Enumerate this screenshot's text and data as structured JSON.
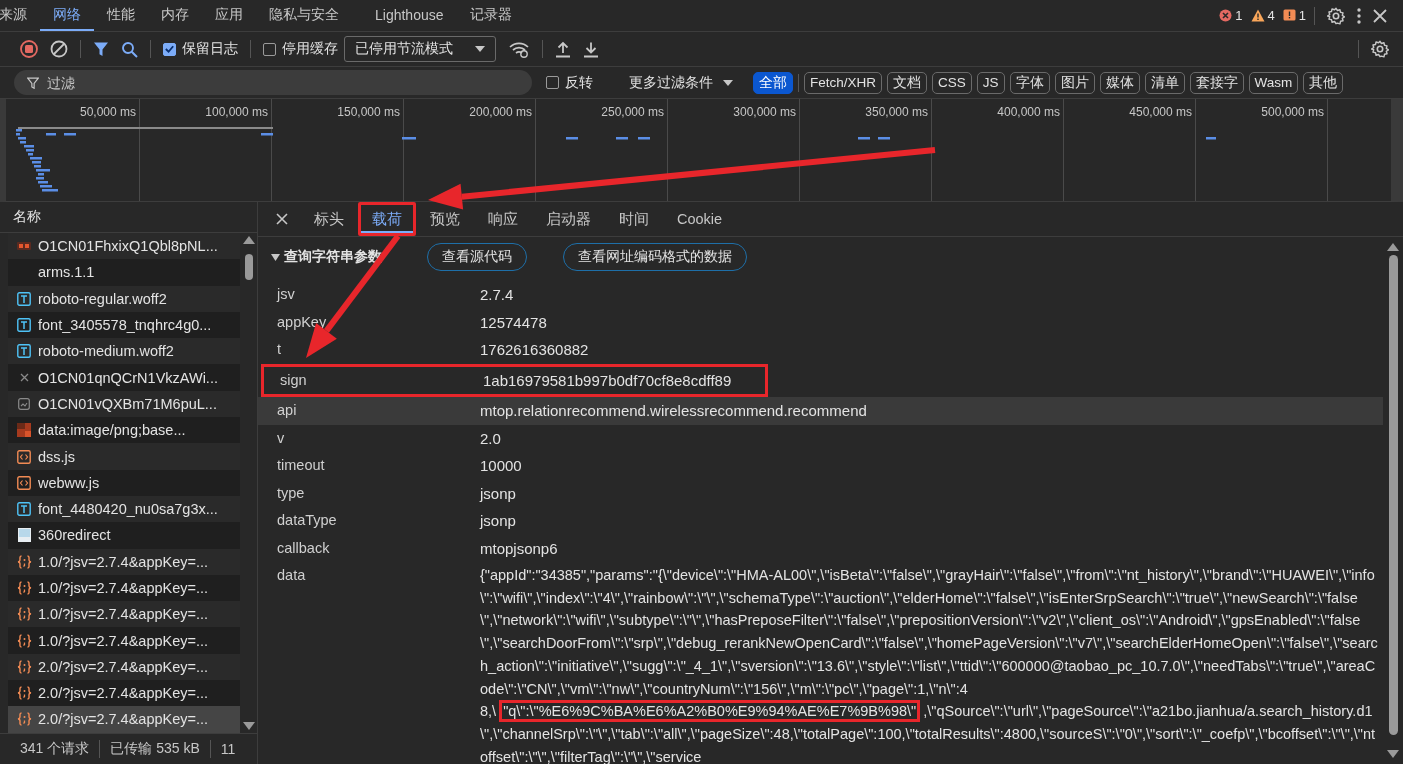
{
  "panel_tabs": [
    {
      "label": "来源",
      "selected": false
    },
    {
      "label": "网络",
      "selected": true
    },
    {
      "label": "性能",
      "selected": false
    },
    {
      "label": "内存",
      "selected": false
    },
    {
      "label": "应用",
      "selected": false
    },
    {
      "label": "隐私与安全",
      "selected": false
    },
    {
      "label": "Lighthouse",
      "selected": false
    },
    {
      "label": "记录器",
      "selected": false
    }
  ],
  "issue_counts": [
    {
      "kind": "error",
      "count": "1"
    },
    {
      "kind": "warning",
      "count": "4"
    },
    {
      "kind": "info",
      "count": "1"
    }
  ],
  "toolbar": {
    "preserve_log": {
      "label": "保留日志",
      "checked": true
    },
    "disable_cache": {
      "label": "停用缓存",
      "checked": false
    },
    "throttling": "已停用节流模式"
  },
  "filter": {
    "placeholder": "过滤",
    "invert": {
      "label": "反转",
      "checked": false
    },
    "more_filters": "更多过滤条件",
    "types": [
      {
        "label": "全部",
        "selected": true
      },
      {
        "label": "Fetch/XHR",
        "selected": false
      },
      {
        "label": "文档",
        "selected": false
      },
      {
        "label": "CSS",
        "selected": false
      },
      {
        "label": "JS",
        "selected": false
      },
      {
        "label": "字体",
        "selected": false
      },
      {
        "label": "图片",
        "selected": false
      },
      {
        "label": "媒体",
        "selected": false
      },
      {
        "label": "清单",
        "selected": false
      },
      {
        "label": "套接字",
        "selected": false
      },
      {
        "label": "Wasm",
        "selected": false
      },
      {
        "label": "其他",
        "selected": false
      }
    ]
  },
  "overview_ticks": [
    "50,000 ms",
    "100,000 ms",
    "150,000 ms",
    "200,000 ms",
    "250,000 ms",
    "300,000 ms",
    "350,000 ms",
    "400,000 ms",
    "450,000 ms",
    "500,000 ms"
  ],
  "requests": {
    "column": "名称",
    "items": [
      {
        "kind": "logo",
        "name": "O1CN01FhxixQ1Qbl8pNL...",
        "selected": false
      },
      {
        "kind": "none",
        "name": "arms.1.1",
        "selected": false
      },
      {
        "kind": "font",
        "name": "roboto-regular.woff2",
        "selected": false
      },
      {
        "kind": "font",
        "name": "font_3405578_tnqhrc4g0...",
        "selected": false
      },
      {
        "kind": "font",
        "name": "roboto-medium.woff2",
        "selected": false
      },
      {
        "kind": "failed",
        "name": "O1CN01qnQCrN1VkzAWi...",
        "selected": false
      },
      {
        "kind": "broken-image",
        "name": "O1CN01vQXBm71M6puL...",
        "selected": false
      },
      {
        "kind": "image",
        "name": "data:image/png;base...",
        "selected": false
      },
      {
        "kind": "script",
        "name": "dss.js",
        "selected": false
      },
      {
        "kind": "script",
        "name": "webww.js",
        "selected": false
      },
      {
        "kind": "font",
        "name": "font_4480420_nu0sa7g3x...",
        "selected": false
      },
      {
        "kind": "page",
        "name": "360redirect",
        "selected": false
      },
      {
        "kind": "xhr",
        "name": "1.0/?jsv=2.7.4&appKey=...",
        "selected": false
      },
      {
        "kind": "xhr",
        "name": "1.0/?jsv=2.7.4&appKey=...",
        "selected": false
      },
      {
        "kind": "xhr",
        "name": "1.0/?jsv=2.7.4&appKey=...",
        "selected": false
      },
      {
        "kind": "xhr",
        "name": "1.0/?jsv=2.7.4&appKey=...",
        "selected": false
      },
      {
        "kind": "xhr",
        "name": "2.0/?jsv=2.7.4&appKey=...",
        "selected": false
      },
      {
        "kind": "xhr",
        "name": "2.0/?jsv=2.7.4&appKey=...",
        "selected": false
      },
      {
        "kind": "xhr",
        "name": "2.0/?jsv=2.7.4&appKey=...",
        "selected": true
      }
    ]
  },
  "status_bar": [
    "341 个请求",
    "已传输 535 kB",
    "11"
  ],
  "detail_tabs": [
    {
      "label": "标头",
      "selected": false,
      "highlighted": false
    },
    {
      "label": "载荷",
      "selected": true,
      "highlighted": true
    },
    {
      "label": "预览",
      "selected": false,
      "highlighted": false
    },
    {
      "label": "响应",
      "selected": false,
      "highlighted": false
    },
    {
      "label": "启动器",
      "selected": false,
      "highlighted": false
    },
    {
      "label": "时间",
      "selected": false,
      "highlighted": false
    },
    {
      "label": "Cookie",
      "selected": false,
      "highlighted": false
    }
  ],
  "section": {
    "title": "查询字符串参数",
    "expanded": true,
    "buttons": [
      "查看源代码",
      "查看网址编码格式的数据"
    ]
  },
  "params": [
    {
      "name": "jsv",
      "value": "2.7.4",
      "hovered": false,
      "highlighted": false
    },
    {
      "name": "appKey",
      "value": "12574478",
      "hovered": false,
      "highlighted": false
    },
    {
      "name": "t",
      "value": "1762616360882",
      "hovered": false,
      "highlighted": false
    },
    {
      "name": "sign",
      "value": "1ab16979581b997b0df70cf8e8cdff89",
      "hovered": false,
      "highlighted": true
    },
    {
      "name": "api",
      "value": "mtop.relationrecommend.wirelessrecommend.recommend",
      "hovered": true,
      "highlighted": false
    },
    {
      "name": "v",
      "value": "2.0",
      "hovered": false,
      "highlighted": false
    },
    {
      "name": "timeout",
      "value": "10000",
      "hovered": false,
      "highlighted": false
    },
    {
      "name": "type",
      "value": "jsonp",
      "hovered": false,
      "highlighted": false
    },
    {
      "name": "dataType",
      "value": "jsonp",
      "hovered": false,
      "highlighted": false
    },
    {
      "name": "callback",
      "value": "mtopjsonp6",
      "hovered": false,
      "highlighted": false
    },
    {
      "name": "data",
      "hovered": false,
      "highlighted": false,
      "value_parts": [
        {
          "text": "{\"appId\":\"34385\",\"params\":\"{\\\"device\\\":\\\"HMA-AL00\\\",\\\"isBeta\\\":\\\"false\\\",\\\"grayHair\\\":\\\"false\\\",\\\"from\\\":\\\"nt_history\\\",\\\"brand\\\":\\\"HUAWEI\\\",\\\"info\\\":\\\"wifi\\\",\\\"index\\\":\\\"4\\\",\\\"rainbow\\\":\\\"\\\",\\\"schemaType\\\":\\\"auction\\\",\\\"elderHome\\\":\\\"false\\\",\\\"isEnterSrpSearch\\\":\\\"true\\\",\\\"newSearch\\\":\\\"false\\\",\\\"network\\\":\\\"wifi\\\",\\\"subtype\\\":\\\"\\\",\\\"hasPreposeFilter\\\":\\\"false\\\",\\\"prepositionVersion\\\":\\\"v2\\\",\\\"client_os\\\":\\\"Android\\\",\\\"gpsEnabled\\\":\\\"false\\\",\\\"searchDoorFrom\\\":\\\"srp\\\",\\\"debug_rerankNewOpenCard\\\":\\\"false\\\",\\\"homePageVersion\\\":\\\"v7\\\",\\\"searchElderHomeOpen\\\":\\\"false\\\",\\\"search_action\\\":\\\"initiative\\\",\\\"sugg\\\":\\\"_4_1\\\",\\\"sversion\\\":\\\"13.6\\\",\\\"style\\\":\\\"list\\\",\\\"ttid\\\":\\\"600000@taobao_pc_10.7.0\\\",\\\"needTabs\\\":\\\"true\\\",\\\"areaCode\\\":\\\"CN\\\",\\\"vm\\\":\\\"nw\\\",\\\"countryNum\\\":\\\"156\\\",\\\"m\\\":\\\"pc\\\",\\\"page\\\":1,\\\"n\\\":48,\\",
          "highlighted": false
        },
        {
          "text": "\"q\\\":\\\"%E6%9C%BA%E6%A2%B0%E9%94%AE%E7%9B%98\\\"",
          "highlighted": true
        },
        {
          "text": ",\\\"qSource\\\":\\\"url\\\",\\\"pageSource\\\":\\\"a21bo.jianhua/a.search_history.d1\\\",\\\"channelSrp\\\":\\\"\\\",\\\"tab\\\":\\\"all\\\",\\\"pageSize\\\":48,\\\"totalPage\\\":100,\\\"totalResults\\\":4800,\\\"sourceS\\\":\\\"0\\\",\\\"sort\\\":\\\"_coefp\\\",\\\"bcoffset\\\":\\\"\\\",\\\"ntoffset\\\":\\\"\\\",\\\"filterTag\\\":\\\"\\\",\\\"service",
          "highlighted": false
        }
      ]
    }
  ]
}
